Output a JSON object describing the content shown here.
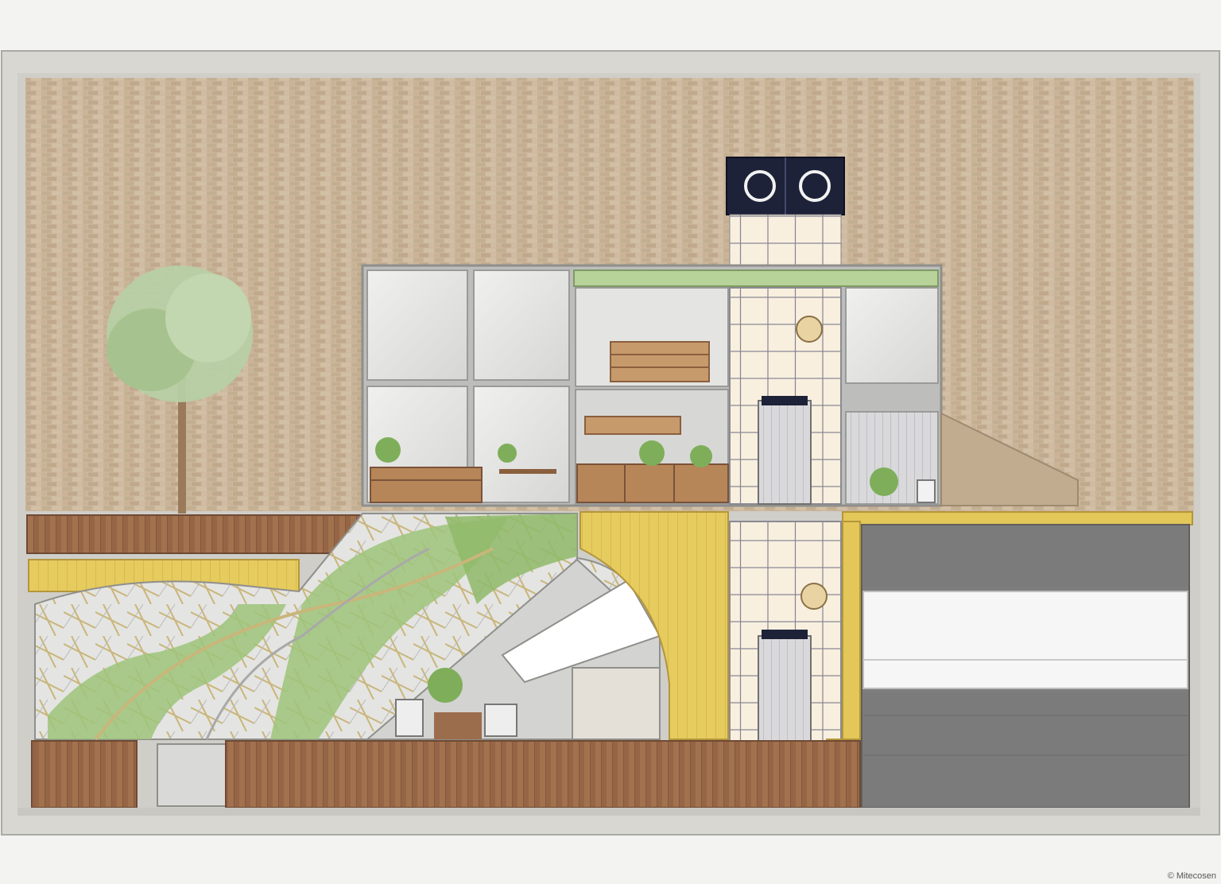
{
  "credit": {
    "text": "© Mitecosen"
  },
  "colors": {
    "paper": "#f3f3f1",
    "frame": "#d9d8d3",
    "brick": "#c9b59a",
    "mortar": "#d8cdb9",
    "wood": "#9c6d4c",
    "wood_dark": "#7a523a",
    "yellow": "#e3c758",
    "glass": "#e8e8e6",
    "grid": "#f7eedd",
    "grid_line": "#8f8f97",
    "navy": "#1d2238",
    "green": "#9ec47a",
    "green_dark": "#6f9e4e",
    "garage_dark": "#7b7b7b",
    "garage_light": "#f6f6f6",
    "steel": "#9a9a9a"
  },
  "icons": [
    "wall-clock-icon",
    "wall-clock-icon",
    "tree-icon",
    "plant-icon"
  ]
}
